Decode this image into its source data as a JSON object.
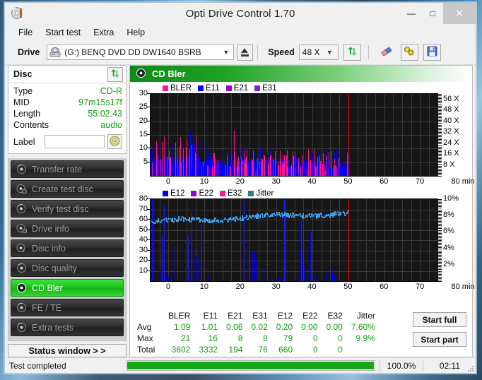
{
  "window": {
    "title": "Opti Drive Control 1.70",
    "app_icon": "disc-icon",
    "minimize": "—",
    "maximize": "□",
    "close": "✕"
  },
  "menubar": {
    "items": [
      "File",
      "Start test",
      "Extra",
      "Help"
    ]
  },
  "toolbar": {
    "drive_label": "Drive",
    "drive_value": "(G:)   BENQ DVD DD DW1640 BSRB",
    "drive_letter": "(G:)",
    "drive_name": "BENQ DVD DD DW1640 BSRB",
    "eject_icon": "eject-icon",
    "speed_label": "Speed",
    "speed_value": "48 X",
    "refresh_icon": "refresh-arrows-icon",
    "eraser_icon": "eraser-icon",
    "tools_icon": "tools-icon",
    "save_icon": "save-floppy-icon"
  },
  "disc_panel": {
    "title": "Disc",
    "refresh_icon": "refresh-arrows-icon",
    "rows": [
      {
        "key": "Type",
        "value": "CD-R"
      },
      {
        "key": "MID",
        "value": "97m15s17f"
      },
      {
        "key": "Length",
        "value": "55:02.43"
      },
      {
        "key": "Contents",
        "value": "audio"
      }
    ],
    "label_key": "Label",
    "label_value": "",
    "label_placeholder": "",
    "label_button_icon": "cd-disc-icon"
  },
  "nav": {
    "items": [
      {
        "label": "Transfer rate",
        "icon": "disc-icon",
        "active": false
      },
      {
        "label": "Create test disc",
        "icon": "disc-burn-icon",
        "active": false
      },
      {
        "label": "Verify test disc",
        "icon": "disc-check-icon",
        "active": false
      },
      {
        "label": "Drive info",
        "icon": "disc-info-icon",
        "active": false
      },
      {
        "label": "Disc info",
        "icon": "disc-info-icon",
        "active": false
      },
      {
        "label": "Disc quality",
        "icon": "disc-icon",
        "active": false
      },
      {
        "label": "CD Bler",
        "icon": "disc-icon",
        "active": true
      },
      {
        "label": "FE / TE",
        "icon": "disc-icon",
        "active": false
      },
      {
        "label": "Extra tests",
        "icon": "disc-icon",
        "active": false
      }
    ],
    "status_window_button": "Status window > >"
  },
  "panel": {
    "title": "CD Bler",
    "icon": "disc-icon"
  },
  "stats": {
    "columns": [
      "BLER",
      "E11",
      "E21",
      "E31",
      "E12",
      "E22",
      "E32",
      "Jitter"
    ],
    "rows": [
      {
        "label": "Avg",
        "values": [
          "1.09",
          "1.01",
          "0.06",
          "0.02",
          "0.20",
          "0.00",
          "0.00",
          "7.60%"
        ]
      },
      {
        "label": "Max",
        "values": [
          "21",
          "16",
          "8",
          "8",
          "79",
          "0",
          "0",
          "9.9%"
        ]
      },
      {
        "label": "Total",
        "values": [
          "3602",
          "3332",
          "194",
          "76",
          "660",
          "0",
          "0",
          ""
        ]
      }
    ],
    "start_full": "Start full",
    "start_part": "Start part"
  },
  "statusbar": {
    "text": "Test completed",
    "percent_label": "100.0%",
    "percent_value": 100,
    "elapsed": "02:11"
  },
  "colors": {
    "bler": "#ff1493",
    "e11": "#0000ff",
    "e21": "#9400d3",
    "e31": "#7b22c9",
    "e12": "#0000ff",
    "e22": "#9400d3",
    "e32": "#ff1493",
    "jitter": "#3a7a7a",
    "jitter_trace": "#3fa0ea",
    "marker": "#ff0000",
    "accent_green": "#19c419",
    "value_green": "#119c11"
  },
  "chart_data": [
    {
      "id": "bler-chart",
      "type": "bar",
      "title": "CD Bler",
      "xlabel": "min",
      "ylabel": "",
      "xlim": [
        0,
        80
      ],
      "ylim": [
        0,
        30
      ],
      "xticks": [
        0,
        10,
        20,
        30,
        40,
        50,
        60,
        70,
        80
      ],
      "xticklabels": [
        "0",
        "10",
        "20",
        "30",
        "40",
        "50",
        "60",
        "70",
        "80 min"
      ],
      "yticks": [
        5,
        10,
        15,
        20,
        25,
        30
      ],
      "yticklabels": [
        "5",
        "10",
        "15",
        "20",
        "25",
        "30"
      ],
      "right_axis": {
        "label": "X",
        "ticks": [
          8,
          16,
          24,
          32,
          40,
          48,
          56
        ],
        "ticklabels": [
          "8 X",
          "16 X",
          "24 X",
          "32 X",
          "40 X",
          "48 X",
          "56 X"
        ],
        "lim": [
          0,
          60
        ]
      },
      "grid": true,
      "legend": [
        {
          "name": "BLER",
          "color": "#ff1493"
        },
        {
          "name": "E11",
          "color": "#0000ff"
        },
        {
          "name": "E21",
          "color": "#9400d3"
        },
        {
          "name": "E31",
          "color": "#7b22c9"
        }
      ],
      "legend_position": "top-left",
      "data_end_min": 55,
      "marker_min": 55,
      "series": [
        {
          "name": "E11",
          "color": "#0000ff",
          "avg": 1.01,
          "max": 16,
          "total": 3332
        },
        {
          "name": "BLER",
          "color": "#ff1493",
          "avg": 1.09,
          "max": 21,
          "total": 3602
        },
        {
          "name": "E21",
          "color": "#9400d3",
          "avg": 0.06,
          "max": 8,
          "total": 194
        },
        {
          "name": "E31",
          "color": "#7b22c9",
          "avg": 0.02,
          "max": 8,
          "total": 76
        }
      ]
    },
    {
      "id": "e12-jitter-chart",
      "type": "bar",
      "title": "",
      "xlabel": "min",
      "xlim": [
        0,
        80
      ],
      "ylim": [
        0,
        80
      ],
      "xticks": [
        0,
        10,
        20,
        30,
        40,
        50,
        60,
        70,
        80
      ],
      "xticklabels": [
        "0",
        "10",
        "20",
        "30",
        "40",
        "50",
        "60",
        "70",
        "80 min"
      ],
      "yticks": [
        10,
        20,
        30,
        40,
        50,
        60,
        70,
        80
      ],
      "yticklabels": [
        "10",
        "20",
        "30",
        "40",
        "50",
        "60",
        "70",
        "80"
      ],
      "right_axis": {
        "label": "%",
        "ticks": [
          2,
          4,
          6,
          8,
          10
        ],
        "ticklabels": [
          "2%",
          "4%",
          "6%",
          "8%",
          "10%"
        ],
        "lim": [
          0,
          10
        ]
      },
      "grid": true,
      "legend": [
        {
          "name": "E12",
          "color": "#0000ff"
        },
        {
          "name": "E22",
          "color": "#9400d3"
        },
        {
          "name": "E32",
          "color": "#ff1493"
        },
        {
          "name": "Jitter",
          "color": "#3a7a7a"
        }
      ],
      "legend_position": "top-left",
      "data_end_min": 55,
      "marker_min": 55,
      "series": [
        {
          "name": "E12",
          "color": "#0000ff",
          "avg": 0.2,
          "max": 79,
          "total": 660
        },
        {
          "name": "E22",
          "color": "#9400d3",
          "avg": 0.0,
          "max": 0,
          "total": 0
        },
        {
          "name": "E32",
          "color": "#ff1493",
          "avg": 0.0,
          "max": 0,
          "total": 0
        },
        {
          "name": "Jitter",
          "color": "#3fa0ea",
          "avg": "7.60%",
          "max": "9.9%",
          "trace_range_pct": [
            6.8,
            9.2
          ]
        }
      ]
    }
  ]
}
